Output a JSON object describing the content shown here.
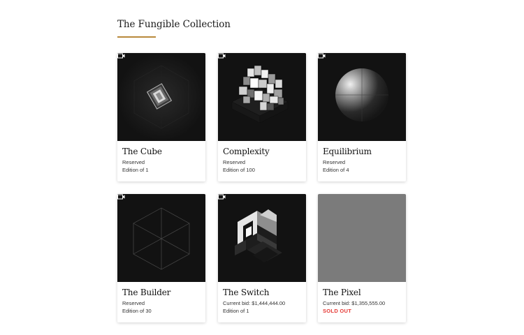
{
  "collection": {
    "title": "The Fungible Collection",
    "accent_color": "#b8893b"
  },
  "cards": [
    {
      "title": "The Cube",
      "status": "Reserved",
      "edition": "Edition of 1",
      "media_icon": "video-icon",
      "art": "cube-in-rhombus"
    },
    {
      "title": "Complexity",
      "status": "Reserved",
      "edition": "Edition of 100",
      "media_icon": "video-icon",
      "art": "voxel-cluster"
    },
    {
      "title": "Equilibrium",
      "status": "Reserved",
      "edition": "Edition of 4",
      "media_icon": "video-icon",
      "art": "sphere"
    },
    {
      "title": "The Builder",
      "status": "Reserved",
      "edition": "Edition of 30",
      "media_icon": "video-icon",
      "art": "wireframe-hexagon"
    },
    {
      "title": "The Switch",
      "status": "Current bid: $1,444,444.00",
      "edition": "Edition of 1",
      "media_icon": "video-icon",
      "art": "isometric-blocks"
    },
    {
      "title": "The Pixel",
      "status": "Current bid: $1,355,555.00",
      "edition": "SOLD OUT",
      "art": "gray-square"
    }
  ],
  "colors": {
    "sold_out": "#e53935",
    "art_background": "#121212",
    "pixel_gray": "#7b7b7b"
  }
}
